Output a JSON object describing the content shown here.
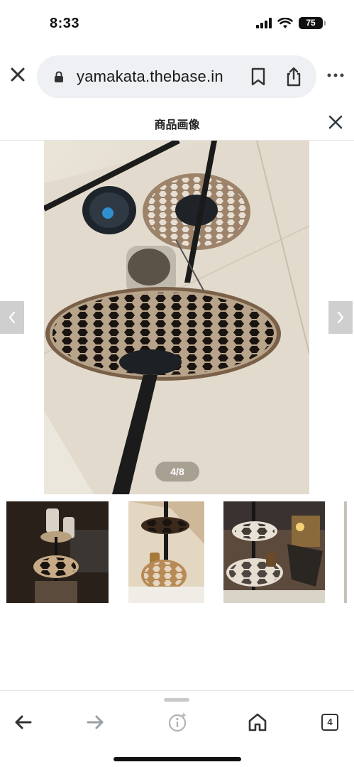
{
  "status": {
    "time": "8:33",
    "battery": "75"
  },
  "browser": {
    "url": "yamakata.thebase.in"
  },
  "viewer": {
    "title": "商品画像",
    "counter": "4/8"
  },
  "toolbar": {
    "tabs_count": "4"
  },
  "colors": {
    "url_pill": "#eef0f3",
    "nav_arrow": "#cfcfcf",
    "forward_disabled": "#9aa0a6"
  }
}
